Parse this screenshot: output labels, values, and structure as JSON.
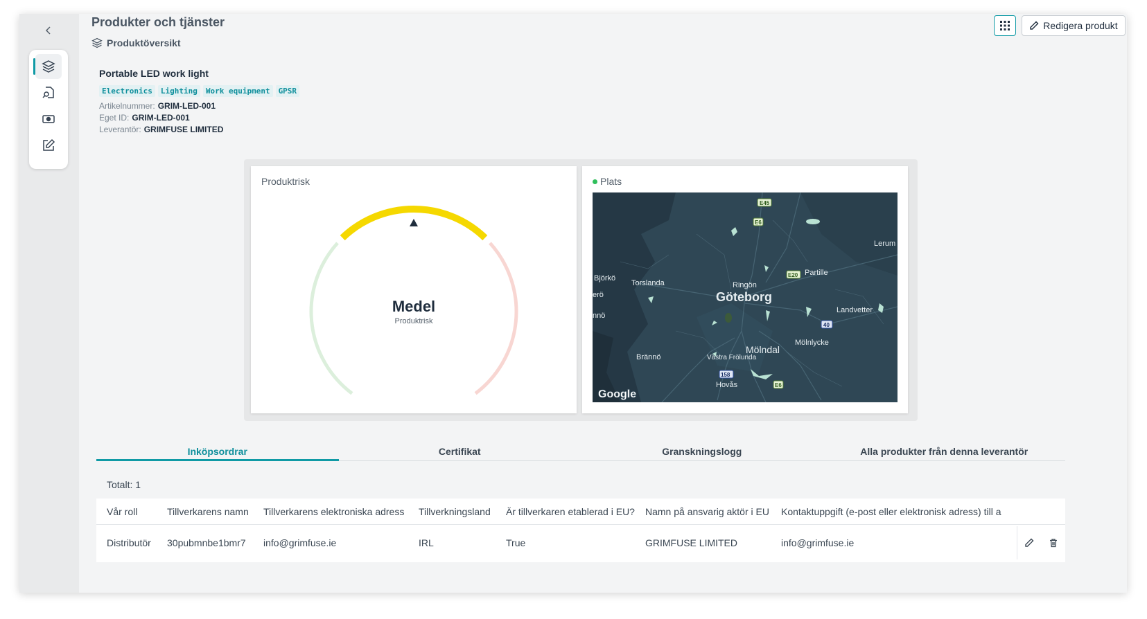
{
  "app": {
    "title": "Produkter och tjänster",
    "subtitle": "Produktöversikt"
  },
  "toolbar": {
    "edit_label": "Redigera produkt"
  },
  "sidebar": {
    "items": [
      {
        "name": "layers-icon",
        "active": true
      },
      {
        "name": "document-search-icon",
        "active": false
      },
      {
        "name": "money-icon",
        "active": false
      },
      {
        "name": "edit-icon",
        "active": false
      }
    ]
  },
  "product": {
    "name": "Portable LED work light",
    "tags": [
      "Electronics",
      "Lighting",
      "Work equipment",
      "GPSR"
    ],
    "fields": [
      {
        "label": "Artikelnummer:",
        "value": "GRIM-LED-001"
      },
      {
        "label": "Eget ID:",
        "value": "GRIM-LED-001"
      },
      {
        "label": "Leverantör:",
        "value": "GRIMFUSE LIMITED"
      }
    ]
  },
  "risk": {
    "title": "Produktrisk",
    "level": "Medel",
    "label": "Produktrisk",
    "level_index": 2,
    "colors": {
      "low": "#dcefdc",
      "medium": "#f5d800",
      "high": "#f8d6d2",
      "marker": "#1f2d3d"
    }
  },
  "location": {
    "title": "Plats",
    "status_color": "#2fbf5b",
    "map": {
      "city": "Göteborg",
      "places": [
        "Torslanda",
        "Ringön",
        "Partille",
        "Lerum",
        "Björkö",
        "Landvetter",
        "Mölnlycke",
        "Mölndal",
        "Västra Frölunda",
        "Brännö",
        "Hovås",
        "erö",
        "nnö"
      ],
      "roads": [
        "E45",
        "E6",
        "E20",
        "40",
        "158",
        "E6"
      ],
      "attribution": "Google"
    }
  },
  "tabs": [
    {
      "label": "Inköpsordrar",
      "active": true
    },
    {
      "label": "Certifikat",
      "active": false
    },
    {
      "label": "Granskningslogg",
      "active": false
    },
    {
      "label": "Alla produkter från denna leverantör",
      "active": false
    }
  ],
  "orders": {
    "total_label": "Totalt: 1",
    "columns": [
      "Vår roll",
      "Tillverkarens namn",
      "Tillverkarens elektroniska adress",
      "Tillverkningsland",
      "Är tillverkaren etablerad i EU?",
      "Namn på ansvarig aktör i EU",
      "Kontaktuppgift (e-post eller elektronisk adress) till a"
    ],
    "rows": [
      [
        "Distributör",
        "30pubmnbe1bmr7",
        "info@grimfuse.ie",
        "IRL",
        "True",
        "GRIMFUSE LIMITED",
        "info@grimfuse.ie"
      ]
    ]
  }
}
